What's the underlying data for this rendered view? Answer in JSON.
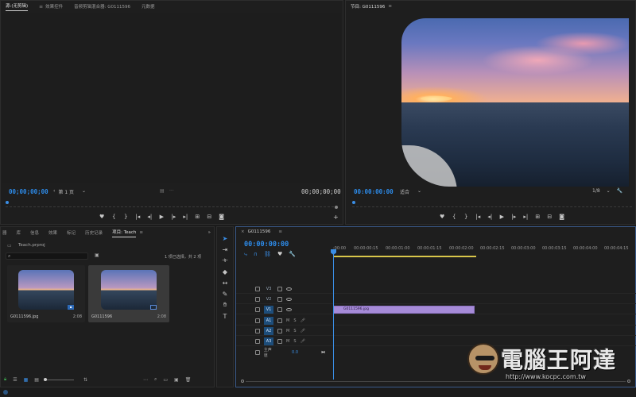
{
  "source_panel": {
    "tabs": [
      "源:(无剪辑)",
      "效果控件",
      "音频剪辑混合器: G0111596",
      "元数据"
    ],
    "timecode_left": "00;00;00;00",
    "page_select": "第 1 页",
    "timecode_right": "00;00;00;00"
  },
  "program_panel": {
    "title": "节目: G0111596",
    "timecode": "00:00:00:00",
    "fit_select": "适合",
    "resolution": "1/8"
  },
  "project_panel": {
    "tabs": [
      "库",
      "信息",
      "效果",
      "标记",
      "历史记录",
      "项目: Teach"
    ],
    "first_tab_partial": "器",
    "file_name": "Teach.prproj",
    "selection_info": "1 项已选择，共 2 项",
    "items": [
      {
        "name": "G0111596.jpg",
        "duration": "2:08"
      },
      {
        "name": "G0111596",
        "duration": "2:08"
      }
    ]
  },
  "timeline_panel": {
    "sequence_tab": "G0111596",
    "timecode": "00:00:00:00",
    "ruler_labels": [
      ":00:00",
      "00:00:00:15",
      "00:00:01:00",
      "00:00:01:15",
      "00:00:02:00",
      "00:00:02:15",
      "00:00:03:00",
      "00:00:03:15",
      "00:00:04:00",
      "00:00:04:15"
    ],
    "video_tracks": [
      "V3",
      "V2",
      "V1"
    ],
    "audio_tracks": [
      "A1",
      "A2",
      "A3"
    ],
    "master_label": "主声道",
    "master_value": "0.0",
    "clip_label": "G0111596.jpg",
    "track_m": "M",
    "track_s": "S"
  },
  "watermark": {
    "brand": "電腦王阿達",
    "url": "http://www.kocpc.com.tw"
  },
  "colors": {
    "accent_blue": "#2d8ceb",
    "clip_purple": "#a68bd8",
    "work_area_yellow": "#d8c64a"
  }
}
